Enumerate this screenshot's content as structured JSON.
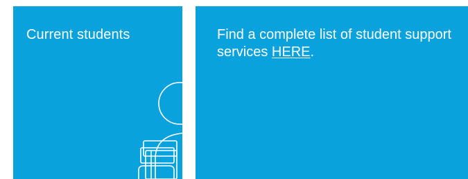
{
  "tiles": {
    "current_students": {
      "title": "Current students",
      "illustration_icon": "student-with-books-icon"
    },
    "support_services": {
      "text_before_link": "Find a complete list of student support services ",
      "link_label": "HERE",
      "text_after_link": "."
    }
  },
  "colors": {
    "tile_background": "#0aa2dc",
    "text": "#ffffff",
    "page_background": "#ffffff"
  }
}
